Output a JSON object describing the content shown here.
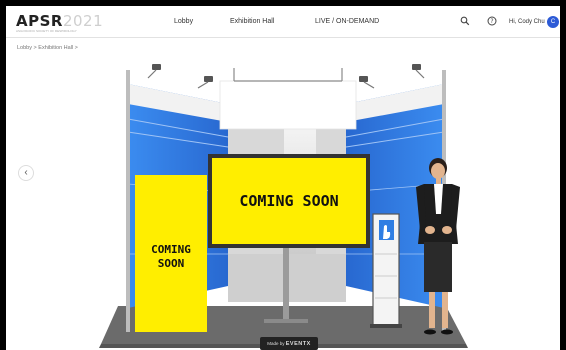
{
  "header": {
    "logo_main": "APSR",
    "logo_year": "2021",
    "logo_subtitle": "ASIA PACIFIC SOCIETY OF RESPIROLOGY"
  },
  "nav": [
    {
      "label": "Lobby"
    },
    {
      "label": "Exhibition Hall"
    },
    {
      "label": "LIVE / ON-DEMAND"
    }
  ],
  "user": {
    "greeting": "Hi, Cody Chu",
    "avatar_initial": "C"
  },
  "breadcrumb": {
    "items": [
      "Lobby",
      "Exhibition Hall"
    ],
    "separator": ">"
  },
  "booth": {
    "screen_text": "COMING SOON",
    "banner_line1": "COMING",
    "banner_line2": "SOON"
  },
  "footer_badge": {
    "prefix": "Made by",
    "brand": "EVENTX"
  },
  "colors": {
    "accent": "#2c5ad6",
    "booth_blue": "#2f7ee3",
    "booth_yellow": "#ffee00",
    "floor": "#6b6b6b"
  }
}
